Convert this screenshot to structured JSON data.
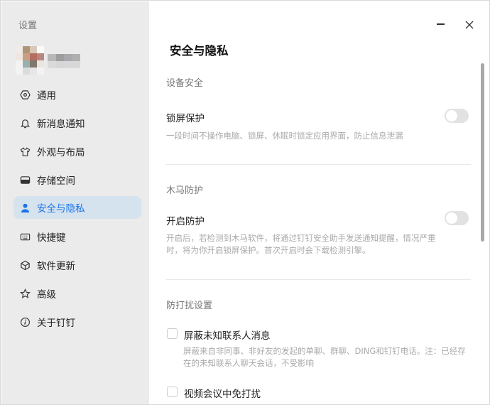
{
  "sidebar": {
    "title": "设置",
    "items": [
      {
        "label": "通用",
        "icon": "hexagon-gear-icon"
      },
      {
        "label": "新消息通知",
        "icon": "bell-icon"
      },
      {
        "label": "外观与布局",
        "icon": "shirt-icon"
      },
      {
        "label": "存储空间",
        "icon": "storage-drive-icon"
      },
      {
        "label": "安全与隐私",
        "icon": "person-icon",
        "active": true
      },
      {
        "label": "快捷键",
        "icon": "keyboard-icon"
      },
      {
        "label": "软件更新",
        "icon": "cube-icon"
      },
      {
        "label": "高级",
        "icon": "star-icon"
      },
      {
        "label": "关于钉钉",
        "icon": "info-icon"
      }
    ]
  },
  "colors": {
    "accent": "#1a73e8",
    "active_bg": "#d5e3ef",
    "sidebar_bg": "#ebebeb"
  },
  "window": {
    "minimize": "minimize-icon",
    "close": "close-icon"
  },
  "main": {
    "title": "安全与隐私",
    "device": {
      "section": "设备安全",
      "label": "锁屏保护",
      "desc": "一段时间不操作电脑、锁屏、休眠时锁定应用界面，防止信息泄漏",
      "enabled": false
    },
    "trojan": {
      "section": "木马防护",
      "label": "开启防护",
      "desc": "开启后，若检测到木马软件，将通过钉钉安全助手发送通知提醒，情况严重时，将为你开启锁屏保护。首次开启时会下载检测引擎。",
      "enabled": false
    },
    "dnd": {
      "section": "防打扰设置",
      "block": {
        "label": "屏蔽未知联系人消息",
        "desc": "屏蔽来自非同事、非好友的发起的单聊、群聊、DING和钉钉电话。注：已经存在的未知联系人聊天会话，不受影响",
        "checked": false
      },
      "meeting": {
        "label": "视频会议中免打扰",
        "checked": false
      }
    }
  }
}
